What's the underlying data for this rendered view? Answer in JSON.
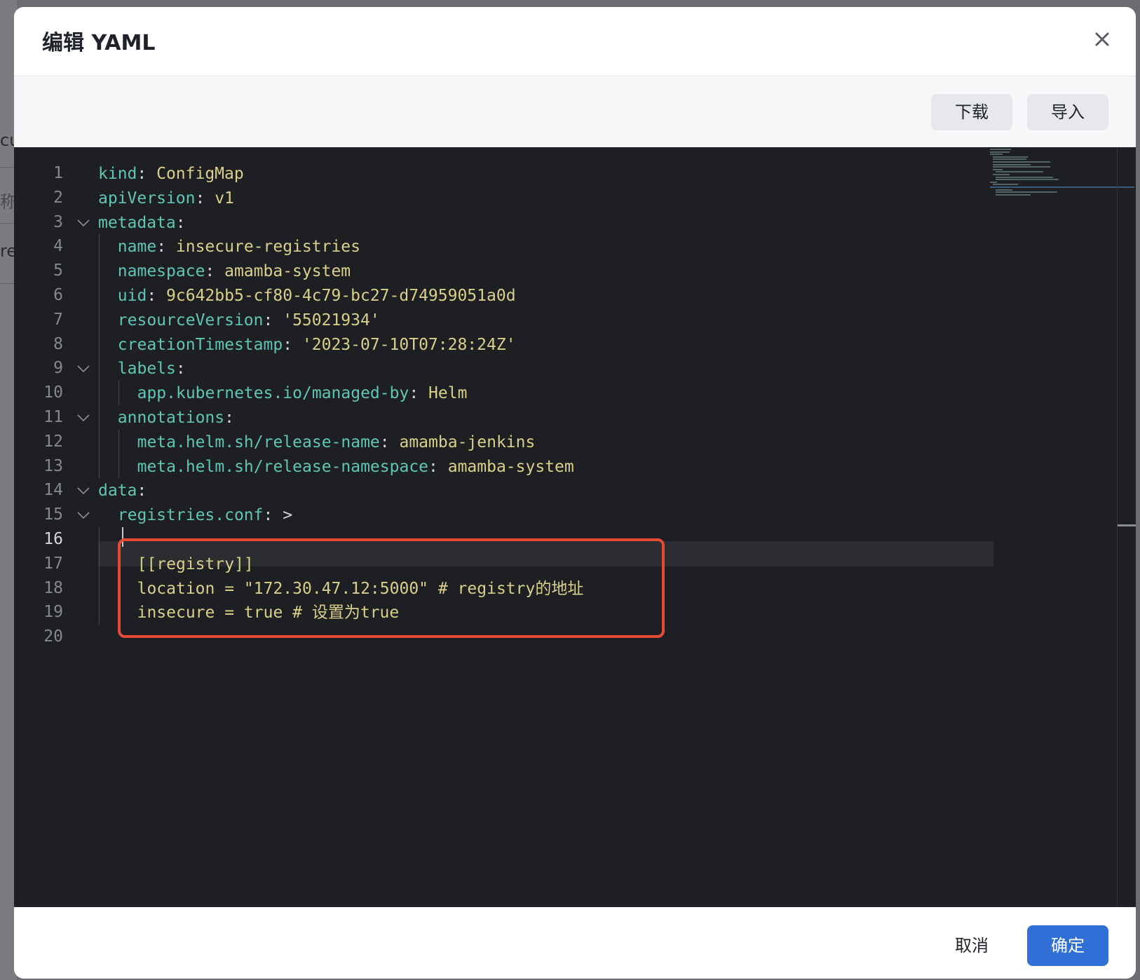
{
  "background": {
    "fragments": [
      "cu",
      "称",
      "re"
    ]
  },
  "dialog": {
    "title": "编辑 YAML",
    "close_icon": "close-icon"
  },
  "toolbar": {
    "download_label": "下载",
    "import_label": "导入"
  },
  "editor": {
    "current_line": 16,
    "lines": [
      {
        "no": "1",
        "tokens": [
          {
            "t": "k",
            "s": "kind"
          },
          {
            "t": "p",
            "s": ": "
          },
          {
            "t": "v",
            "s": "ConfigMap"
          }
        ]
      },
      {
        "no": "2",
        "tokens": [
          {
            "t": "k",
            "s": "apiVersion"
          },
          {
            "t": "p",
            "s": ": "
          },
          {
            "t": "v",
            "s": "v1"
          }
        ]
      },
      {
        "no": "3",
        "tokens": [
          {
            "t": "k",
            "s": "metadata"
          },
          {
            "t": "p",
            "s": ":"
          }
        ]
      },
      {
        "no": "4",
        "tokens": [
          {
            "t": "k",
            "s": "name"
          },
          {
            "t": "p",
            "s": ": "
          },
          {
            "t": "v",
            "s": "insecure-registries"
          }
        ]
      },
      {
        "no": "5",
        "tokens": [
          {
            "t": "k",
            "s": "namespace"
          },
          {
            "t": "p",
            "s": ": "
          },
          {
            "t": "v",
            "s": "amamba-system"
          }
        ]
      },
      {
        "no": "6",
        "tokens": [
          {
            "t": "k",
            "s": "uid"
          },
          {
            "t": "p",
            "s": ": "
          },
          {
            "t": "v",
            "s": "9c642bb5-cf80-4c79-bc27-d74959051a0d"
          }
        ]
      },
      {
        "no": "7",
        "tokens": [
          {
            "t": "k",
            "s": "resourceVersion"
          },
          {
            "t": "p",
            "s": ": "
          },
          {
            "t": "v",
            "s": "'55021934'"
          }
        ]
      },
      {
        "no": "8",
        "tokens": [
          {
            "t": "k",
            "s": "creationTimestamp"
          },
          {
            "t": "p",
            "s": ": "
          },
          {
            "t": "v",
            "s": "'2023-07-10T07:28:24Z'"
          }
        ]
      },
      {
        "no": "9",
        "tokens": [
          {
            "t": "k",
            "s": "labels"
          },
          {
            "t": "p",
            "s": ":"
          }
        ]
      },
      {
        "no": "10",
        "tokens": [
          {
            "t": "k",
            "s": "app.kubernetes.io/managed-by"
          },
          {
            "t": "p",
            "s": ": "
          },
          {
            "t": "v",
            "s": "Helm"
          }
        ]
      },
      {
        "no": "11",
        "tokens": [
          {
            "t": "k",
            "s": "annotations"
          },
          {
            "t": "p",
            "s": ":"
          }
        ]
      },
      {
        "no": "12",
        "tokens": [
          {
            "t": "k",
            "s": "meta.helm.sh/release-name"
          },
          {
            "t": "p",
            "s": ": "
          },
          {
            "t": "v",
            "s": "amamba-jenkins"
          }
        ]
      },
      {
        "no": "13",
        "tokens": [
          {
            "t": "k",
            "s": "meta.helm.sh/release-namespace"
          },
          {
            "t": "p",
            "s": ": "
          },
          {
            "t": "v",
            "s": "amamba-system"
          }
        ]
      },
      {
        "no": "14",
        "tokens": [
          {
            "t": "k",
            "s": "data"
          },
          {
            "t": "p",
            "s": ":"
          }
        ]
      },
      {
        "no": "15",
        "tokens": [
          {
            "t": "k",
            "s": "registries.conf"
          },
          {
            "t": "p",
            "s": ": >"
          }
        ]
      },
      {
        "no": "16",
        "tokens": []
      },
      {
        "no": "17",
        "tokens": [
          {
            "t": "v",
            "s": "[[registry]]"
          }
        ]
      },
      {
        "no": "18",
        "tokens": [
          {
            "t": "v",
            "s": "location = \"172.30.47.12:5000\" # registry的地址"
          }
        ]
      },
      {
        "no": "19",
        "tokens": [
          {
            "t": "v",
            "s": "insecure = true # 设置为true"
          }
        ]
      },
      {
        "no": "20",
        "tokens": []
      }
    ]
  },
  "footer": {
    "cancel_label": "取消",
    "ok_label": "确定"
  },
  "colors": {
    "yaml_key": "#5fc6b5",
    "yaml_value": "#d8d08a",
    "editor_background": "#1e1f22",
    "highlight_box": "#e54a35",
    "primary_button": "#2f6fd6"
  }
}
